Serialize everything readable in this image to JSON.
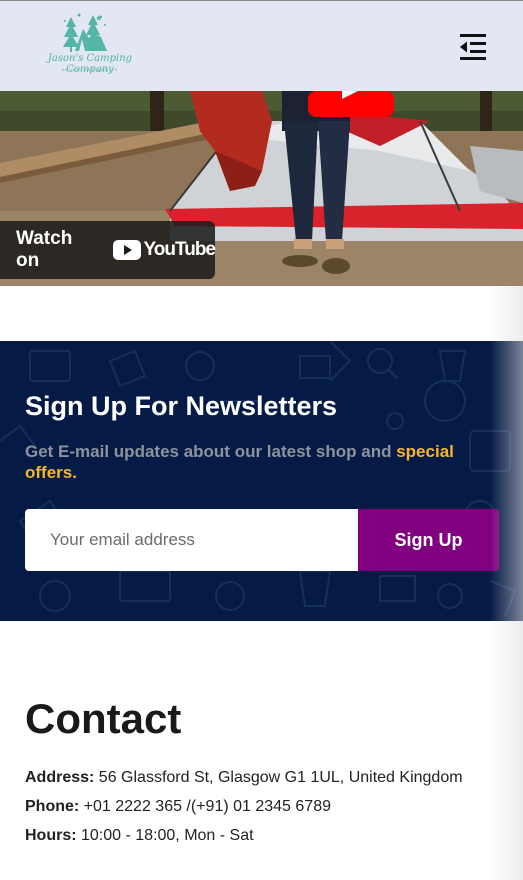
{
  "header": {
    "logo_text": "Jason's Camping Company",
    "logo_subtext": "ADVENTURE AWAITS",
    "logo_icon": "camping-tent-logo",
    "menu_icon": "menu-collapse-icon"
  },
  "video": {
    "watch_on": "Watch on",
    "youtube_label": "YouTube",
    "play_icon": "youtube-play-icon"
  },
  "newsletter": {
    "title": "Sign Up For Newsletters",
    "description_prefix": "Get E-mail updates about our latest shop and ",
    "description_highlight": "special offers.",
    "email_placeholder": "Your email address",
    "email_value": "",
    "button_label": "Sign Up",
    "colors": {
      "background": "#051b45",
      "highlight": "#f8b42a",
      "button": "#800080"
    }
  },
  "contact": {
    "title": "Contact",
    "address_label": "Address:",
    "address_value": " 56 Glassford St, Glasgow G1 1UL, United Kingdom",
    "phone_label": "Phone:",
    "phone_value": " +01 2222 365 /(+91) 01 2345 6789",
    "hours_label": "Hours:",
    "hours_value": " 10:00 - 18:00, Mon - Sat"
  }
}
